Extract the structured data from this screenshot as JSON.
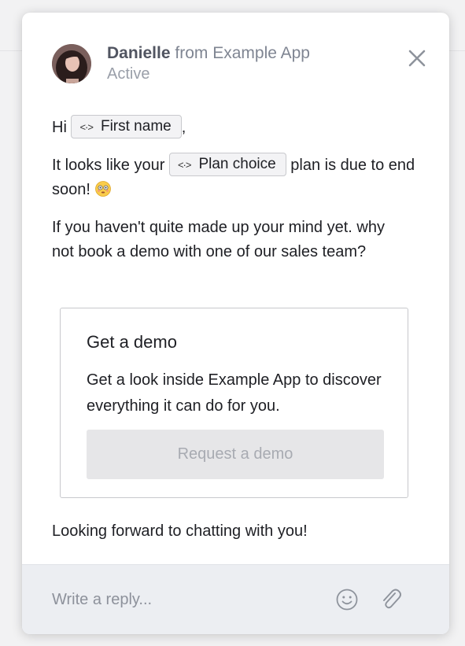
{
  "header": {
    "sender_name": "Danielle",
    "sender_suffix": "from Example App",
    "status": "Active"
  },
  "message": {
    "greeting": "Hi",
    "first_name_chip": "First name",
    "greeting_punct": ",",
    "plan_prefix": "It looks like your",
    "plan_chip": "Plan choice",
    "plan_suffix": "plan is due to end soon!",
    "paragraph": "If you haven't quite made up your mind yet. why not book a demo with one of our sales team?",
    "closing": "Looking forward to chatting with you!"
  },
  "demo_card": {
    "title": "Get a demo",
    "description": "Get a look inside Example App to discover everything it can do for you.",
    "button_label": "Request a demo"
  },
  "composer": {
    "placeholder": "Write a reply..."
  },
  "icons": {
    "chip": "variable-code-icon",
    "close": "close-icon",
    "emoji_reaction": "flushed-face-emoji",
    "emoji_button": "smiley-icon",
    "attach": "paperclip-icon"
  },
  "colors": {
    "chip_bg": "#f3f3f5",
    "button_bg": "#e6e6e8",
    "footer_bg": "#eceef2"
  }
}
